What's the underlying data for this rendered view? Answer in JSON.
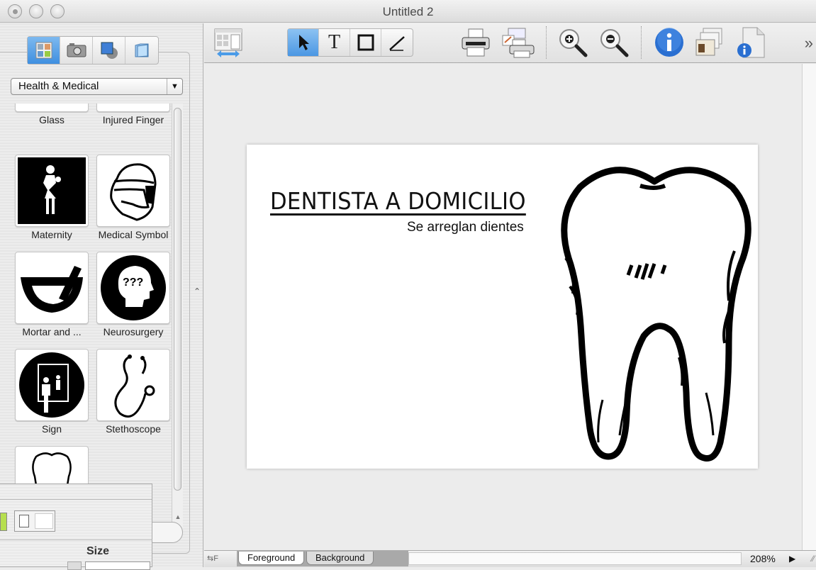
{
  "window": {
    "title": "Untitled 2"
  },
  "library": {
    "source_tabs": [
      {
        "name": "clip-art",
        "icon": "clipart-grid-icon",
        "active": true
      },
      {
        "name": "photos",
        "icon": "camera-icon",
        "active": false
      },
      {
        "name": "shapes",
        "icon": "shapes-icon",
        "active": false
      },
      {
        "name": "folder",
        "icon": "folder-icon",
        "active": false
      }
    ],
    "category": "Health & Medical",
    "items": [
      {
        "label": "Glass"
      },
      {
        "label": "Injured Finger"
      },
      {
        "label": "Maternity"
      },
      {
        "label": "Medical Symbol"
      },
      {
        "label": "Mortar and ..."
      },
      {
        "label": "Neurosurgery"
      },
      {
        "label": "Sign"
      },
      {
        "label": "Stethoscope"
      },
      {
        "label": ""
      }
    ]
  },
  "inspector": {
    "size_label": "Size",
    "stroke_color": "#b6df4f"
  },
  "toolbar": {
    "items": [
      {
        "name": "toggle-library",
        "icon": "library-toggle-icon"
      },
      {
        "name": "select-tool",
        "icon": "arrow-pointer-icon",
        "active": true
      },
      {
        "name": "text-tool",
        "icon": "text-icon",
        "glyph": "T"
      },
      {
        "name": "rectangle-tool",
        "icon": "rectangle-icon"
      },
      {
        "name": "line-tool",
        "icon": "line-icon"
      },
      {
        "name": "print",
        "icon": "printer-icon"
      },
      {
        "name": "print-batch",
        "icon": "print-batch-icon"
      },
      {
        "name": "zoom-in",
        "icon": "zoom-in-icon"
      },
      {
        "name": "zoom-out",
        "icon": "zoom-out-icon"
      },
      {
        "name": "info",
        "icon": "info-icon"
      },
      {
        "name": "address-book",
        "icon": "address-cards-icon"
      },
      {
        "name": "document-info",
        "icon": "document-info-icon"
      }
    ],
    "overflow": "»"
  },
  "document": {
    "title": "DENTISTA A DOMICILIO",
    "subtitle": "Se arreglan dientes"
  },
  "statusbar": {
    "layer_toggle": "F",
    "tabs": [
      {
        "label": "Foreground",
        "active": true
      },
      {
        "label": "Background",
        "active": false
      }
    ],
    "zoom": "208%"
  }
}
